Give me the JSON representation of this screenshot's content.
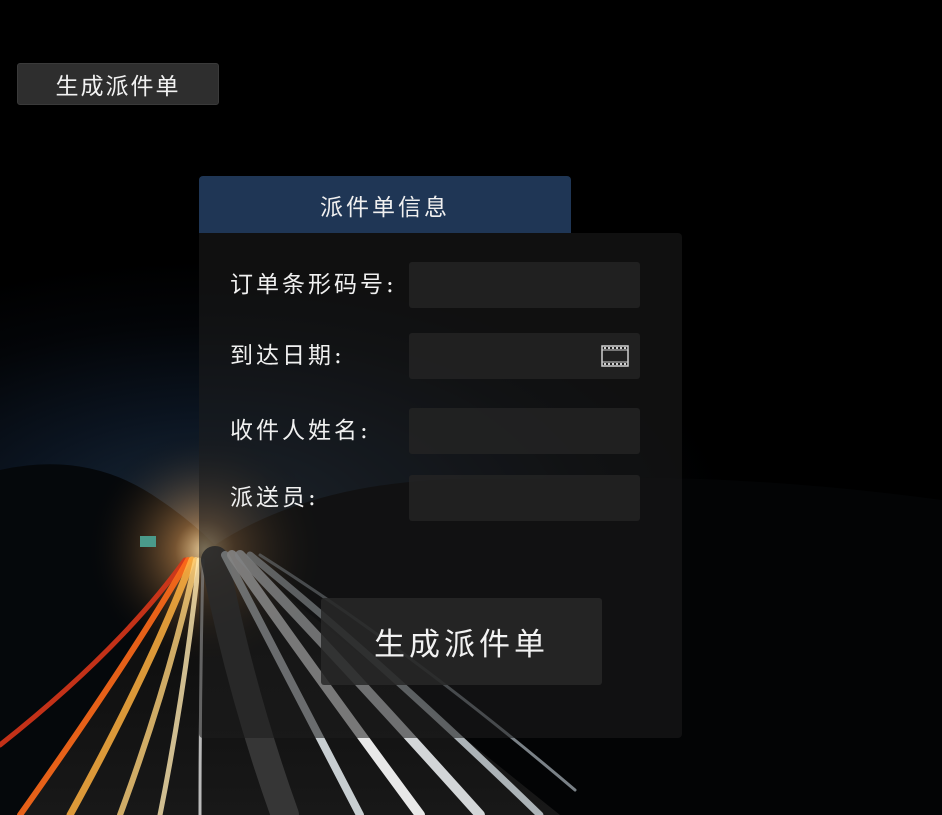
{
  "top_button": {
    "label": "生成派件单"
  },
  "panel": {
    "title": "派件单信息",
    "fields": [
      {
        "label": "订单条形码号:",
        "value": "",
        "placeholder": ""
      },
      {
        "label": "到达日期:",
        "value": "",
        "placeholder": "",
        "icon": "calendar-icon"
      },
      {
        "label": "收件人姓名:",
        "value": "",
        "placeholder": ""
      },
      {
        "label": "派送员:",
        "value": "",
        "placeholder": ""
      }
    ],
    "submit_label": "生成派件单"
  },
  "colors": {
    "header_bg": "#1f3655",
    "button_bg": "#2e2e2e",
    "text": "#f0f0f0"
  }
}
